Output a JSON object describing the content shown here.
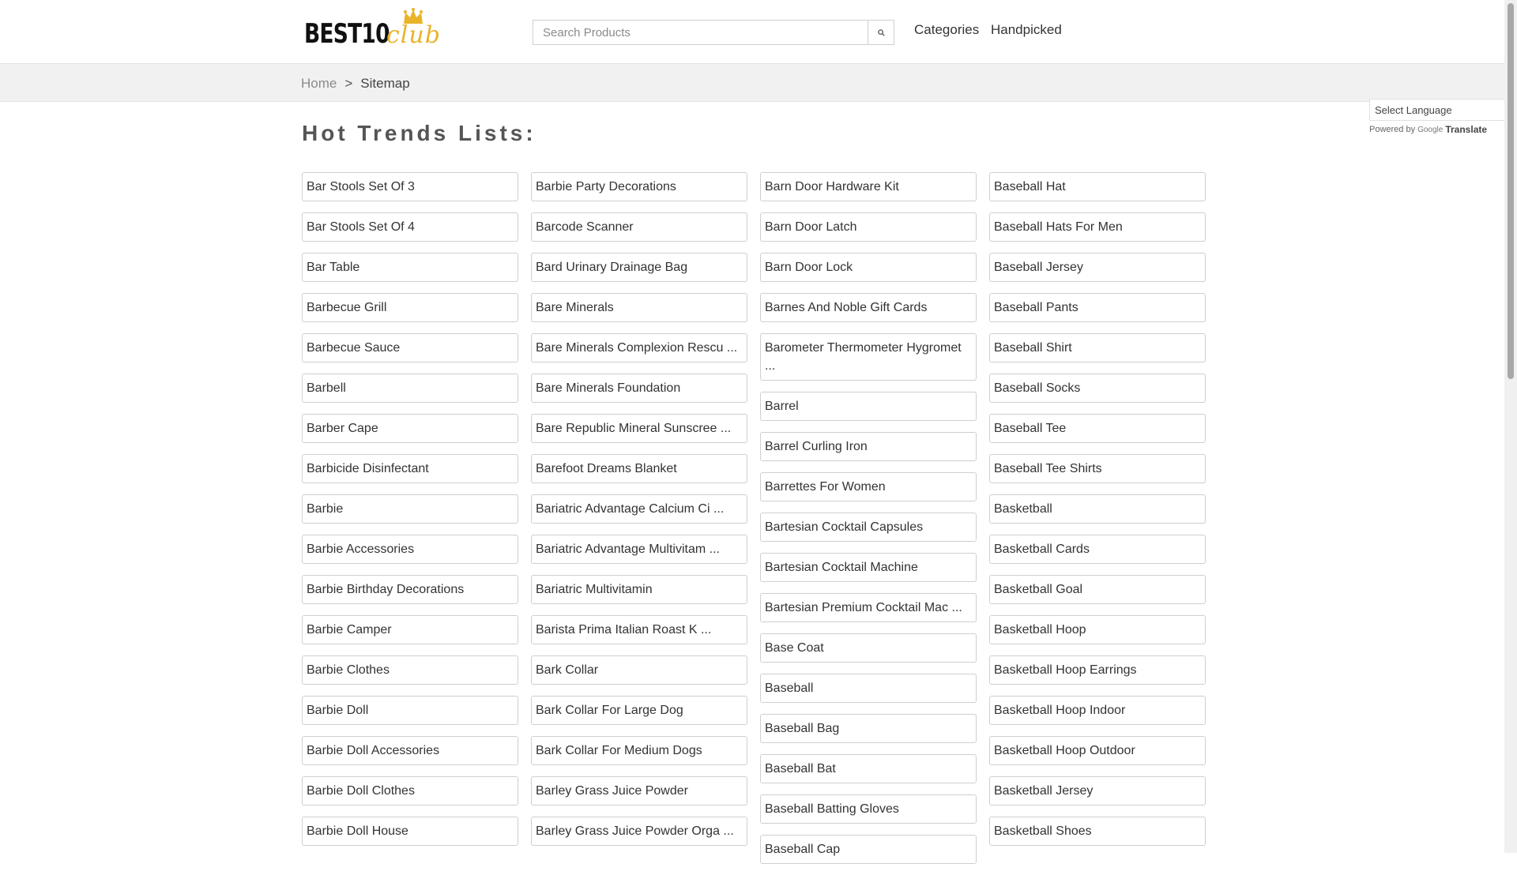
{
  "header": {
    "logo": {
      "best": "BEST10",
      "club": "club"
    },
    "search": {
      "placeholder": "Search Products",
      "icon": "search-icon"
    },
    "nav": {
      "categories": "Categories",
      "handpicked": "Handpicked"
    }
  },
  "breadcrumb": {
    "home": "Home",
    "separator": ">",
    "current": "Sitemap"
  },
  "translate": {
    "select_label": "Select Language",
    "powered_by": "Powered by",
    "google": "Google",
    "translate": "Translate"
  },
  "page_title": "Hot Trends Lists:",
  "columns": [
    [
      "Bar Stools Set Of 3",
      "Bar Stools Set Of 4",
      "Bar Table",
      "Barbecue Grill",
      "Barbecue Sauce",
      "Barbell",
      "Barber Cape",
      "Barbicide Disinfectant",
      "Barbie",
      "Barbie Accessories",
      "Barbie Birthday Decorations",
      "Barbie Camper",
      "Barbie Clothes",
      "Barbie Doll",
      "Barbie Doll Accessories",
      "Barbie Doll Clothes",
      "Barbie Doll House"
    ],
    [
      "Barbie Party Decorations",
      "Barcode Scanner",
      "Bard Urinary Drainage Bag",
      "Bare Minerals",
      "Bare Minerals Complexion Rescu ...",
      "Bare Minerals Foundation",
      "Bare Republic Mineral Sunscree ...",
      "Barefoot Dreams Blanket",
      "Bariatric Advantage Calcium Ci ...",
      "Bariatric Advantage Multivitam ...",
      "Bariatric Multivitamin",
      "Barista Prima Italian Roast K ...",
      "Bark Collar",
      "Bark Collar For Large Dog",
      "Bark Collar For Medium Dogs",
      "Barley Grass Juice Powder",
      "Barley Grass Juice Powder Orga ..."
    ],
    [
      "Barn Door Hardware Kit",
      "Barn Door Latch",
      "Barn Door Lock",
      "Barnes And Noble Gift Cards",
      "Barometer Thermometer Hygromet ...",
      "Barrel",
      "Barrel Curling Iron",
      "Barrettes For Women",
      "Bartesian Cocktail Capsules",
      "Bartesian Cocktail Machine",
      "Bartesian Premium Cocktail Mac ...",
      "Base Coat",
      "Baseball",
      "Baseball Bag",
      "Baseball Bat",
      "Baseball Batting Gloves",
      "Baseball Cap"
    ],
    [
      "Baseball Hat",
      "Baseball Hats For Men",
      "Baseball Jersey",
      "Baseball Pants",
      "Baseball Shirt",
      "Baseball Socks",
      "Baseball Tee",
      "Baseball Tee Shirts",
      "Basketball",
      "Basketball Cards",
      "Basketball Goal",
      "Basketball Hoop",
      "Basketball Hoop Earrings",
      "Basketball Hoop Indoor",
      "Basketball Hoop Outdoor",
      "Basketball Jersey",
      "Basketball Shoes"
    ]
  ],
  "colors": {
    "accent": "#e9b42a",
    "text": "#333333",
    "muted": "#8a8a8a",
    "border": "#cfcfcf",
    "band": "#f1f1f1"
  }
}
